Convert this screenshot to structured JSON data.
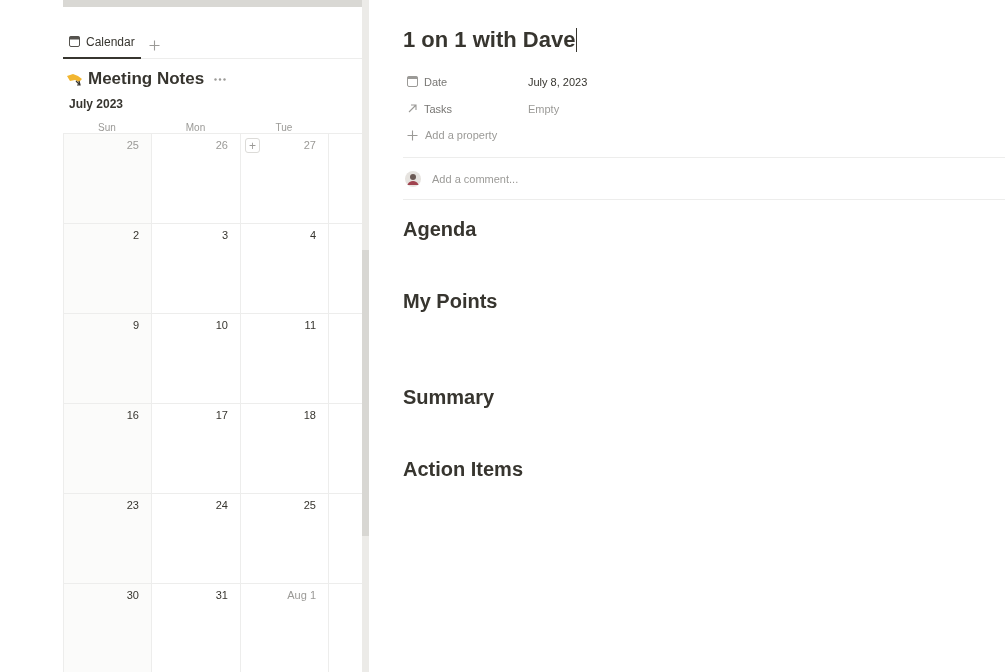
{
  "calendar_view": {
    "tabs": [
      {
        "label": "Calendar",
        "selected": true
      }
    ],
    "title": "Meeting Notes",
    "month": "July 2023",
    "weekdays": [
      "Sun",
      "Mon",
      "Tue"
    ],
    "weeks": [
      [
        {
          "day": "25",
          "outside": true
        },
        {
          "day": "26",
          "outside": true
        },
        {
          "day": "27",
          "outside": true,
          "add_button": "+"
        }
      ],
      [
        {
          "day": "2",
          "outside": false
        },
        {
          "day": "3",
          "outside": false
        },
        {
          "day": "4",
          "outside": false
        }
      ],
      [
        {
          "day": "9",
          "outside": false
        },
        {
          "day": "10",
          "outside": false
        },
        {
          "day": "11",
          "outside": false
        }
      ],
      [
        {
          "day": "16",
          "outside": false
        },
        {
          "day": "17",
          "outside": false
        },
        {
          "day": "18",
          "outside": false
        }
      ],
      [
        {
          "day": "23",
          "outside": false
        },
        {
          "day": "24",
          "outside": false
        },
        {
          "day": "25",
          "outside": false
        }
      ],
      [
        {
          "day": "30",
          "outside": false
        },
        {
          "day": "31",
          "outside": false
        },
        {
          "day": "Aug 1",
          "outside": true
        }
      ]
    ]
  },
  "page": {
    "title": "1 on 1 with Dave",
    "properties": [
      {
        "kind": "date",
        "name": "Date",
        "value": "July 8, 2023",
        "empty": false
      },
      {
        "kind": "relation",
        "name": "Tasks",
        "value": "Empty",
        "empty": true
      }
    ],
    "add_property": "Add a property",
    "comment_placeholder": "Add a comment...",
    "headings": [
      "Agenda",
      "My Points",
      "Summary",
      "Action Items"
    ]
  }
}
